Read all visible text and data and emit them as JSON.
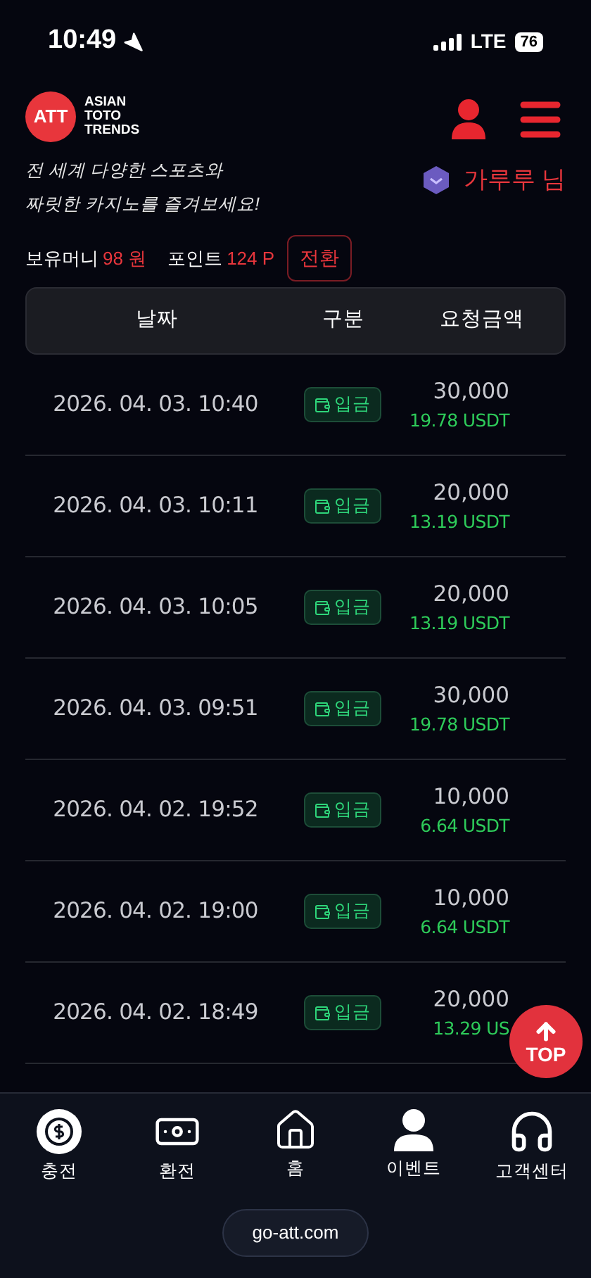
{
  "status_bar": {
    "time": "10:49",
    "network": "LTE",
    "battery": "76"
  },
  "header": {
    "logo_mark": "ATT",
    "logo_text": [
      "ASIAN",
      "TOTO",
      "TRENDS"
    ],
    "tagline": [
      "전 세계 다양한 스포츠와",
      "짜릿한 카지노를 즐겨보세요!"
    ],
    "user_name": "가루루 님"
  },
  "balance": {
    "money_label": "보유머니",
    "money_value": "98 원",
    "points_label": "포인트",
    "points_value": "124 P",
    "convert_button": "전환"
  },
  "table": {
    "columns": [
      "날짜",
      "구분",
      "요청금액"
    ],
    "rows": [
      {
        "date": "2026. 04. 03. 10:40",
        "type": "입금",
        "amount": "30,000",
        "usdt": "19.78 USDT"
      },
      {
        "date": "2026. 04. 03. 10:11",
        "type": "입금",
        "amount": "20,000",
        "usdt": "13.19 USDT"
      },
      {
        "date": "2026. 04. 03. 10:05",
        "type": "입금",
        "amount": "20,000",
        "usdt": "13.19 USDT"
      },
      {
        "date": "2026. 04. 03. 09:51",
        "type": "입금",
        "amount": "30,000",
        "usdt": "19.78 USDT"
      },
      {
        "date": "2026. 04. 02. 19:52",
        "type": "입금",
        "amount": "10,000",
        "usdt": "6.64 USDT"
      },
      {
        "date": "2026. 04. 02. 19:00",
        "type": "입금",
        "amount": "10,000",
        "usdt": "6.64 USDT"
      },
      {
        "date": "2026. 04. 02. 18:49",
        "type": "입금",
        "amount": "20,000",
        "usdt": "13.29 US"
      }
    ]
  },
  "top_button": "TOP",
  "bottom_nav": [
    {
      "kind": "chip",
      "label": "충전"
    },
    {
      "kind": "cash",
      "label": "환전"
    },
    {
      "kind": "home",
      "label": "홈"
    },
    {
      "kind": "person",
      "label": "이벤트"
    },
    {
      "kind": "headset",
      "label": "고객센터"
    }
  ],
  "url": "go-att.com"
}
